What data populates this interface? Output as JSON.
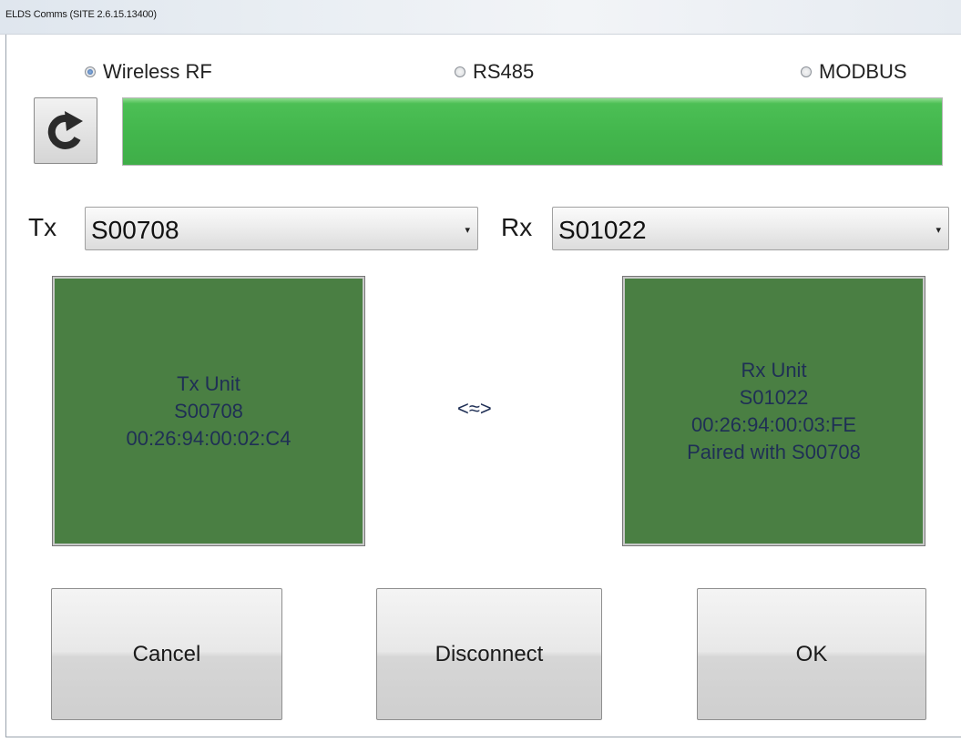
{
  "window": {
    "title": "ELDS Comms (SITE 2.6.15.13400)"
  },
  "comm_modes": [
    {
      "label": "Wireless RF",
      "selected": true
    },
    {
      "label": "RS485",
      "selected": false
    },
    {
      "label": "MODBUS",
      "selected": false
    }
  ],
  "progress": {
    "fraction": 1.0,
    "color": "#4cbf55"
  },
  "tx": {
    "label": "Tx",
    "selected": "S00708"
  },
  "rx": {
    "label": "Rx",
    "selected": "S01022"
  },
  "tx_unit": {
    "line1": "Tx Unit",
    "line2": "S00708",
    "line3": "00:26:94:00:02:C4"
  },
  "rx_unit": {
    "line1": "Rx Unit",
    "line2": "S01022",
    "line3": "00:26:94:00:03:FE",
    "line4": "Paired with S00708"
  },
  "link_symbol": "<≈>",
  "buttons": {
    "cancel": "Cancel",
    "disconnect": "Disconnect",
    "ok": "OK"
  },
  "colors": {
    "unit_card": "#4a7f43",
    "unit_text": "#1f2f55"
  },
  "icons": {
    "refresh": "refresh-icon",
    "dropdown": "chevron-down-icon"
  }
}
